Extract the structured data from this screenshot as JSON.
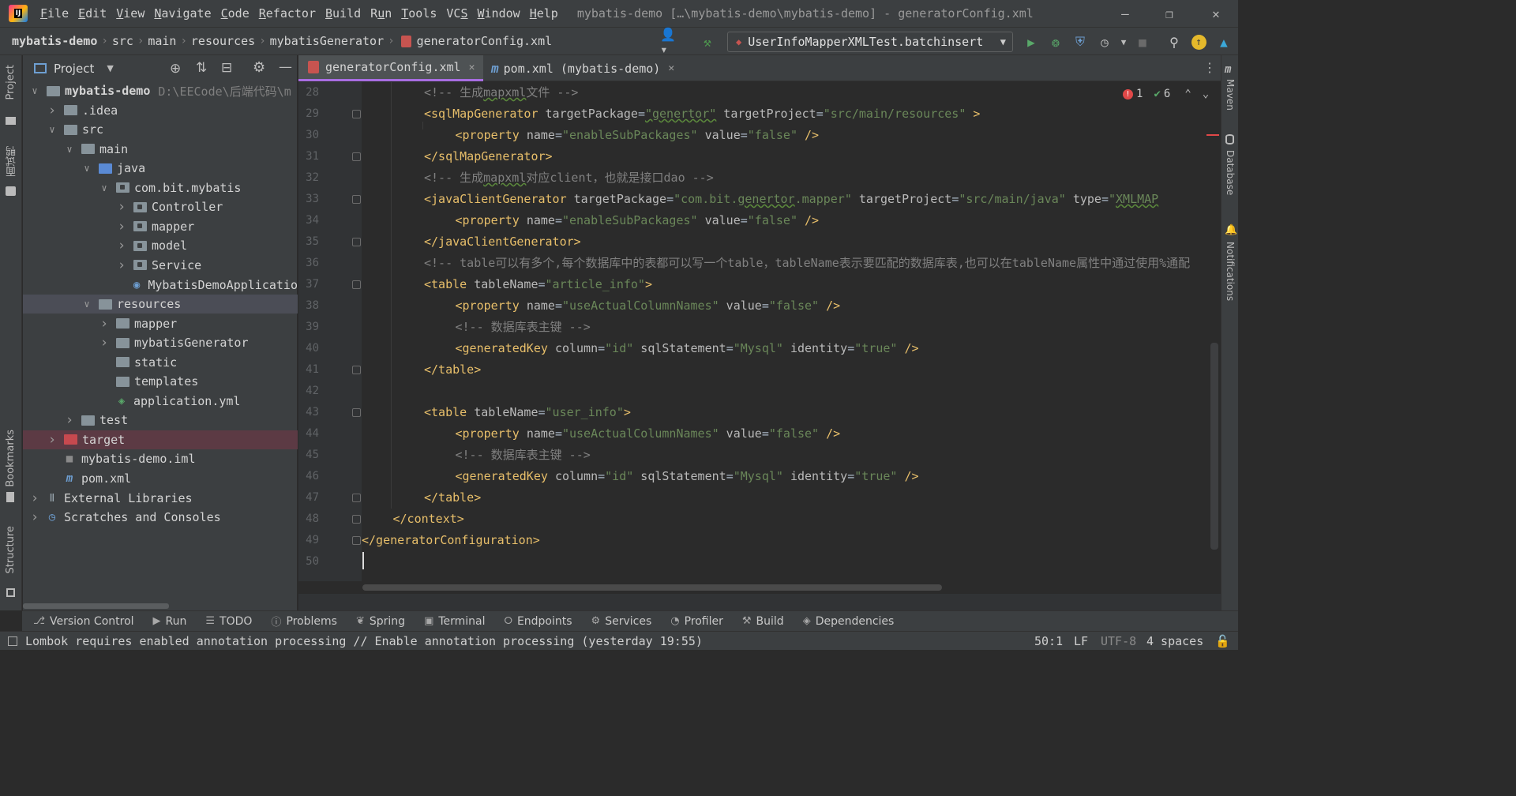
{
  "menubar": {
    "items": [
      "File",
      "Edit",
      "View",
      "Navigate",
      "Code",
      "Refactor",
      "Build",
      "Run",
      "Tools",
      "VCS",
      "Window",
      "Help"
    ],
    "mnemonics": [
      "F",
      "E",
      "V",
      "N",
      "C",
      "R",
      "B",
      "u",
      "T",
      "S",
      "W",
      "H"
    ],
    "title": "mybatis-demo […\\mybatis-demo\\mybatis-demo] - generatorConfig.xml"
  },
  "breadcrumb": [
    "mybatis-demo",
    "src",
    "main",
    "resources",
    "mybatisGenerator",
    "generatorConfig.xml"
  ],
  "run_config": "UserInfoMapperXMLTest.batchinsert",
  "project_panel": {
    "title": "Project",
    "tree": [
      {
        "label": "mybatis-demo",
        "path": "D:\\EECode\\后端代码\\m",
        "depth": 0,
        "arrow": "down",
        "icon": "module"
      },
      {
        "label": ".idea",
        "depth": 1,
        "arrow": "right",
        "icon": "folder"
      },
      {
        "label": "src",
        "depth": 1,
        "arrow": "down",
        "icon": "folder"
      },
      {
        "label": "main",
        "depth": 2,
        "arrow": "down",
        "icon": "folder"
      },
      {
        "label": "java",
        "depth": 3,
        "arrow": "down",
        "icon": "folder-blue"
      },
      {
        "label": "com.bit.mybatis",
        "depth": 4,
        "arrow": "down",
        "icon": "package"
      },
      {
        "label": "Controller",
        "depth": 5,
        "arrow": "right",
        "icon": "package"
      },
      {
        "label": "mapper",
        "depth": 5,
        "arrow": "right",
        "icon": "package"
      },
      {
        "label": "model",
        "depth": 5,
        "arrow": "right",
        "icon": "package"
      },
      {
        "label": "Service",
        "depth": 5,
        "arrow": "right",
        "icon": "package"
      },
      {
        "label": "MybatisDemoApplicatio",
        "depth": 5,
        "arrow": "none",
        "icon": "spring-class"
      },
      {
        "label": "resources",
        "depth": 3,
        "arrow": "down",
        "icon": "folder-res",
        "selected": true
      },
      {
        "label": "mapper",
        "depth": 4,
        "arrow": "right",
        "icon": "folder"
      },
      {
        "label": "mybatisGenerator",
        "depth": 4,
        "arrow": "right",
        "icon": "folder"
      },
      {
        "label": "static",
        "depth": 4,
        "arrow": "none",
        "icon": "folder"
      },
      {
        "label": "templates",
        "depth": 4,
        "arrow": "none",
        "icon": "folder"
      },
      {
        "label": "application.yml",
        "depth": 4,
        "arrow": "none",
        "icon": "yml"
      },
      {
        "label": "test",
        "depth": 2,
        "arrow": "right",
        "icon": "folder"
      },
      {
        "label": "target",
        "depth": 1,
        "arrow": "right",
        "icon": "folder-red",
        "excluded": true
      },
      {
        "label": "mybatis-demo.iml",
        "depth": 1,
        "arrow": "none",
        "icon": "iml"
      },
      {
        "label": "pom.xml",
        "depth": 1,
        "arrow": "none",
        "icon": "maven"
      },
      {
        "label": "External Libraries",
        "depth": 0,
        "arrow": "right",
        "icon": "libraries"
      },
      {
        "label": "Scratches and Consoles",
        "depth": 0,
        "arrow": "right",
        "icon": "scratches"
      }
    ]
  },
  "editor_tabs": [
    {
      "label": "generatorConfig.xml",
      "active": true
    },
    {
      "label": "pom.xml (mybatis-demo)",
      "active": false
    }
  ],
  "inspections": {
    "errors": "1",
    "ok": "6"
  },
  "code_lines": [
    {
      "n": "28",
      "indent": 2,
      "tokens": [
        [
          "c",
          "<!-- 生成"
        ],
        [
          "cw",
          "mapxml"
        ],
        [
          "c",
          "文件 -->"
        ]
      ]
    },
    {
      "n": "29",
      "indent": 2,
      "tokens": [
        [
          "t",
          "<sqlMapGenerator "
        ],
        [
          "a",
          "targetPackage"
        ],
        [
          "p",
          "="
        ],
        [
          "vw",
          "\"genertor\""
        ],
        [
          "a",
          " targetProject"
        ],
        [
          "p",
          "="
        ],
        [
          "v",
          "\"src/main/resources\""
        ],
        [
          "t",
          " >"
        ]
      ]
    },
    {
      "n": "30",
      "indent": 3,
      "tokens": [
        [
          "t",
          "<property "
        ],
        [
          "a",
          "name"
        ],
        [
          "p",
          "="
        ],
        [
          "v",
          "\"enableSubPackages\""
        ],
        [
          "a",
          " value"
        ],
        [
          "p",
          "="
        ],
        [
          "v",
          "\"false\""
        ],
        [
          "t",
          " />"
        ]
      ]
    },
    {
      "n": "31",
      "indent": 2,
      "tokens": [
        [
          "t",
          "</sqlMapGenerator>"
        ]
      ]
    },
    {
      "n": "32",
      "indent": 2,
      "tokens": [
        [
          "c",
          "<!-- 生成"
        ],
        [
          "cw",
          "mapxml"
        ],
        [
          "c",
          "对应client，也就是接口dao -->"
        ]
      ]
    },
    {
      "n": "33",
      "indent": 2,
      "tokens": [
        [
          "t",
          "<javaClientGenerator "
        ],
        [
          "a",
          "targetPackage"
        ],
        [
          "p",
          "="
        ],
        [
          "v",
          "\"com.bit."
        ],
        [
          "vw",
          "genertor"
        ],
        [
          "v",
          ".mapper\""
        ],
        [
          "a",
          " targetProject"
        ],
        [
          "p",
          "="
        ],
        [
          "v",
          "\"src/main/java\""
        ],
        [
          "a",
          " type"
        ],
        [
          "p",
          "="
        ],
        [
          "v",
          "\""
        ],
        [
          "vw",
          "XMLMAP"
        ]
      ]
    },
    {
      "n": "34",
      "indent": 3,
      "tokens": [
        [
          "t",
          "<property "
        ],
        [
          "a",
          "name"
        ],
        [
          "p",
          "="
        ],
        [
          "v",
          "\"enableSubPackages\""
        ],
        [
          "a",
          " value"
        ],
        [
          "p",
          "="
        ],
        [
          "v",
          "\"false\""
        ],
        [
          "t",
          " />"
        ]
      ]
    },
    {
      "n": "35",
      "indent": 2,
      "tokens": [
        [
          "t",
          "</javaClientGenerator>"
        ]
      ]
    },
    {
      "n": "36",
      "indent": 2,
      "tokens": [
        [
          "c",
          "<!-- table可以有多个,每个数据库中的表都可以写一个table，tableName表示要匹配的数据库表,也可以在tableName属性中通过使用%通配"
        ]
      ]
    },
    {
      "n": "37",
      "indent": 2,
      "tokens": [
        [
          "t",
          "<table "
        ],
        [
          "a",
          "tableName"
        ],
        [
          "p",
          "="
        ],
        [
          "v",
          "\"article_info\""
        ],
        [
          "t",
          ">"
        ]
      ]
    },
    {
      "n": "38",
      "indent": 3,
      "tokens": [
        [
          "t",
          "<property "
        ],
        [
          "a",
          "name"
        ],
        [
          "p",
          "="
        ],
        [
          "v",
          "\"useActualColumnNames\""
        ],
        [
          "a",
          " value"
        ],
        [
          "p",
          "="
        ],
        [
          "v",
          "\"false\""
        ],
        [
          "t",
          " />"
        ]
      ]
    },
    {
      "n": "39",
      "indent": 3,
      "tokens": [
        [
          "c",
          "<!-- 数据库表主键 -->"
        ]
      ]
    },
    {
      "n": "40",
      "indent": 3,
      "tokens": [
        [
          "t",
          "<generatedKey "
        ],
        [
          "a",
          "column"
        ],
        [
          "p",
          "="
        ],
        [
          "v",
          "\"id\""
        ],
        [
          "a",
          " sqlStatement"
        ],
        [
          "p",
          "="
        ],
        [
          "v",
          "\"Mysql\""
        ],
        [
          "a",
          " identity"
        ],
        [
          "p",
          "="
        ],
        [
          "v",
          "\"true\""
        ],
        [
          "t",
          " />"
        ]
      ]
    },
    {
      "n": "41",
      "indent": 2,
      "tokens": [
        [
          "t",
          "</table>"
        ]
      ]
    },
    {
      "n": "42",
      "indent": 0,
      "tokens": []
    },
    {
      "n": "43",
      "indent": 2,
      "tokens": [
        [
          "t",
          "<table "
        ],
        [
          "a",
          "tableName"
        ],
        [
          "p",
          "="
        ],
        [
          "v",
          "\"user_info\""
        ],
        [
          "t",
          ">"
        ]
      ]
    },
    {
      "n": "44",
      "indent": 3,
      "tokens": [
        [
          "t",
          "<property "
        ],
        [
          "a",
          "name"
        ],
        [
          "p",
          "="
        ],
        [
          "v",
          "\"useActualColumnNames\""
        ],
        [
          "a",
          " value"
        ],
        [
          "p",
          "="
        ],
        [
          "v",
          "\"false\""
        ],
        [
          "t",
          " />"
        ]
      ]
    },
    {
      "n": "45",
      "indent": 3,
      "tokens": [
        [
          "c",
          "<!-- 数据库表主键 -->"
        ]
      ]
    },
    {
      "n": "46",
      "indent": 3,
      "tokens": [
        [
          "t",
          "<generatedKey "
        ],
        [
          "a",
          "column"
        ],
        [
          "p",
          "="
        ],
        [
          "v",
          "\"id\""
        ],
        [
          "a",
          " sqlStatement"
        ],
        [
          "p",
          "="
        ],
        [
          "v",
          "\"Mysql\""
        ],
        [
          "a",
          " identity"
        ],
        [
          "p",
          "="
        ],
        [
          "v",
          "\"true\""
        ],
        [
          "t",
          " />"
        ]
      ]
    },
    {
      "n": "47",
      "indent": 2,
      "tokens": [
        [
          "t",
          "</table>"
        ]
      ]
    },
    {
      "n": "48",
      "indent": 1,
      "tokens": [
        [
          "t",
          "</context>"
        ]
      ]
    },
    {
      "n": "49",
      "indent": 0,
      "tokens": [
        [
          "t",
          "</generatorConfiguration>"
        ]
      ]
    },
    {
      "n": "50",
      "indent": 0,
      "tokens": []
    }
  ],
  "left_strip": [
    "Project",
    "面试鸭",
    "Bookmarks",
    "Structure"
  ],
  "right_strip": [
    "Maven",
    "Database",
    "Notifications"
  ],
  "bottom_tools": [
    {
      "label": "Version Control",
      "icon": "branch-icon"
    },
    {
      "label": "Run",
      "icon": "run-icon"
    },
    {
      "label": "TODO",
      "icon": "todo-icon"
    },
    {
      "label": "Problems",
      "icon": "problems-icon"
    },
    {
      "label": "Spring",
      "icon": "spring-icon"
    },
    {
      "label": "Terminal",
      "icon": "terminal-icon"
    },
    {
      "label": "Endpoints",
      "icon": "endpoints-icon"
    },
    {
      "label": "Services",
      "icon": "services-icon"
    },
    {
      "label": "Profiler",
      "icon": "profiler-icon"
    },
    {
      "label": "Build",
      "icon": "hammer-icon"
    },
    {
      "label": "Dependencies",
      "icon": "dependencies-icon"
    }
  ],
  "status": {
    "message": "Lombok requires enabled annotation processing // Enable annotation processing (yesterday 19:55)",
    "position": "50:1",
    "line_sep": "LF",
    "encoding": "UTF-8",
    "indent": "4 spaces"
  },
  "colors": {
    "tag": "#e8bf6a",
    "attr": "#bababa",
    "value": "#6a8759",
    "comment": "#808080",
    "accent": "#a86de2"
  }
}
